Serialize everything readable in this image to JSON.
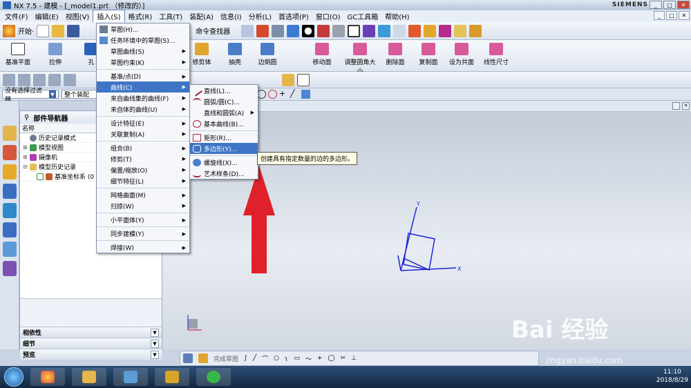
{
  "window": {
    "title": "NX 7.5 - 建模 - [_model1.prt  （修改的）]",
    "brand": "SIEMENS",
    "min": "_",
    "max": "□",
    "close": "✕"
  },
  "menubar": {
    "items": [
      "文件(F)",
      "编辑(E)",
      "视图(V)",
      "插入(S)",
      "格式(R)",
      "工具(T)",
      "装配(A)",
      "信息(I)",
      "分析(L)",
      "首选项(P)",
      "窗口(O)",
      "GC工具箱",
      "帮助(H)"
    ],
    "active_index": 3
  },
  "toolbar1": {
    "start_label": "开始·",
    "cmd_finder": "命令查找器"
  },
  "toolbar2": {
    "buttons": [
      "基准平面",
      "拉伸",
      "孔",
      "修剪体",
      "抽壳",
      "边倒圆",
      "移动面",
      "调整圆角大小",
      "删除面",
      "复制面",
      "设为共面",
      "线性尺寸"
    ]
  },
  "filterbar": {
    "filter_label": "没有选择过滤器",
    "scope_label": "整个装配"
  },
  "navigator": {
    "title": "部件导航器",
    "col_name": "名称",
    "rows": [
      {
        "exp": "",
        "label": "历史记录模式"
      },
      {
        "exp": "⊞",
        "label": "模型视图"
      },
      {
        "exp": "⊞",
        "label": "摄像机"
      },
      {
        "exp": "⊟",
        "label": "模型历史记录"
      },
      {
        "exp": "",
        "label": "基准坐标系 (0"
      }
    ],
    "sections": [
      "相依性",
      "细节",
      "预览"
    ]
  },
  "insert_menu": {
    "items": [
      {
        "label": "草图(H)...",
        "sub": ""
      },
      {
        "label": "任务环境中的草图(S)...",
        "sub": ""
      },
      {
        "label": "草图曲线(S)",
        "sub": "▶"
      },
      {
        "label": "草图约束(K)",
        "sub": "▶"
      },
      {
        "label": "基准/点(D)",
        "sub": "▶"
      },
      {
        "label": "曲线(C)",
        "sub": "▶"
      },
      {
        "label": "来自曲线集的曲线(F)",
        "sub": "▶"
      },
      {
        "label": "来自体的曲线(U)",
        "sub": "▶"
      },
      {
        "label": "设计特征(E)",
        "sub": "▶"
      },
      {
        "label": "关联复制(A)",
        "sub": "▶"
      },
      {
        "label": "组合(B)",
        "sub": "▶"
      },
      {
        "label": "修剪(T)",
        "sub": "▶"
      },
      {
        "label": "偏置/缩放(O)",
        "sub": "▶"
      },
      {
        "label": "细节特征(L)",
        "sub": "▶"
      },
      {
        "label": "网格曲面(M)",
        "sub": "▶"
      },
      {
        "label": "扫掠(W)",
        "sub": "▶"
      },
      {
        "label": "小平面体(Y)",
        "sub": "▶"
      },
      {
        "label": "同步建模(Y)",
        "sub": "▶"
      },
      {
        "label": "焊接(W)",
        "sub": "▶"
      }
    ]
  },
  "curve_menu": {
    "items": [
      {
        "label": "直线(L)...",
        "sub": ""
      },
      {
        "label": "圆弧/圆(C)...",
        "sub": ""
      },
      {
        "label": "直线和圆弧(A)",
        "sub": "▶"
      },
      {
        "label": "基本曲线(B)...",
        "sub": ""
      },
      {
        "label": "矩形(R)...",
        "sub": ""
      },
      {
        "label": "多边形(Y)...",
        "sub": ""
      },
      {
        "label": "螺旋线(X)...",
        "sub": ""
      },
      {
        "label": "艺术样条(D)...",
        "sub": ""
      }
    ]
  },
  "tooltip": "创建具有指定数量的边的多边形。",
  "axes": {
    "x": "X",
    "y": "Y",
    "z": "Z"
  },
  "bottom_toolbar": {
    "sketch_label": "完成草图"
  },
  "taskbar": {
    "time": "11:10",
    "date": "2018/8/29"
  },
  "watermark": {
    "text": "Bai 经验",
    "url": "jingyan.baidu.com"
  },
  "colors": {
    "highlight": "#3f75c7",
    "arrow": "#e0202a",
    "csys": "#1a22d8"
  }
}
